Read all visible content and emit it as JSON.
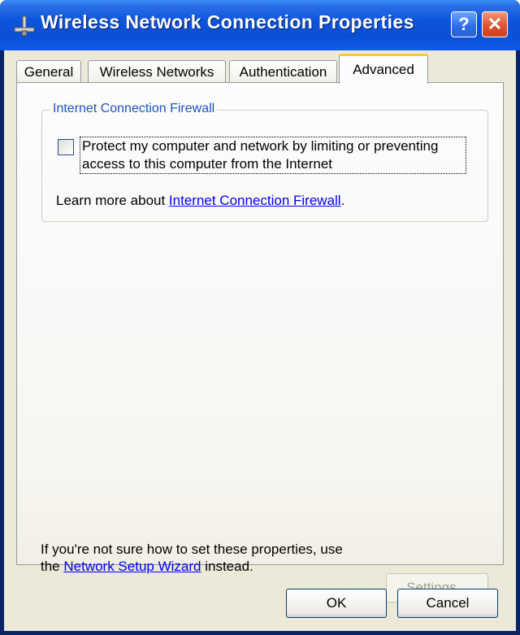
{
  "window": {
    "title": "Wireless Network Connection Properties",
    "help_label": "?",
    "close_label": "✕"
  },
  "tabs": [
    {
      "label": "General"
    },
    {
      "label": "Wireless Networks"
    },
    {
      "label": "Authentication"
    },
    {
      "label": "Advanced",
      "active": true
    }
  ],
  "firewall": {
    "group_title": "Internet Connection Firewall",
    "checkbox_label": "Protect my computer and network by limiting or preventing access to this computer from the Internet",
    "checkbox_checked": false,
    "learn_more_prefix": "Learn more about ",
    "learn_more_link": "Internet Connection Firewall",
    "learn_more_suffix": "."
  },
  "footer": {
    "text_line1": "If you're not sure how to set these properties, use",
    "text_prefix": "the ",
    "wizard_link": "Network Setup Wizard",
    "text_suffix": " instead.",
    "settings_label": "Settings..."
  },
  "buttons": {
    "ok_label": "OK",
    "cancel_label": "Cancel"
  },
  "colors": {
    "titlebar": "#0a4fd4",
    "client_bg": "#ece9d8",
    "link": "#0000ff",
    "group_title": "#1f53c9",
    "active_tab_accent": "#ffc83c"
  },
  "icons": {
    "title_icon": "network-connection-icon",
    "help": "help-icon",
    "close": "close-icon"
  }
}
